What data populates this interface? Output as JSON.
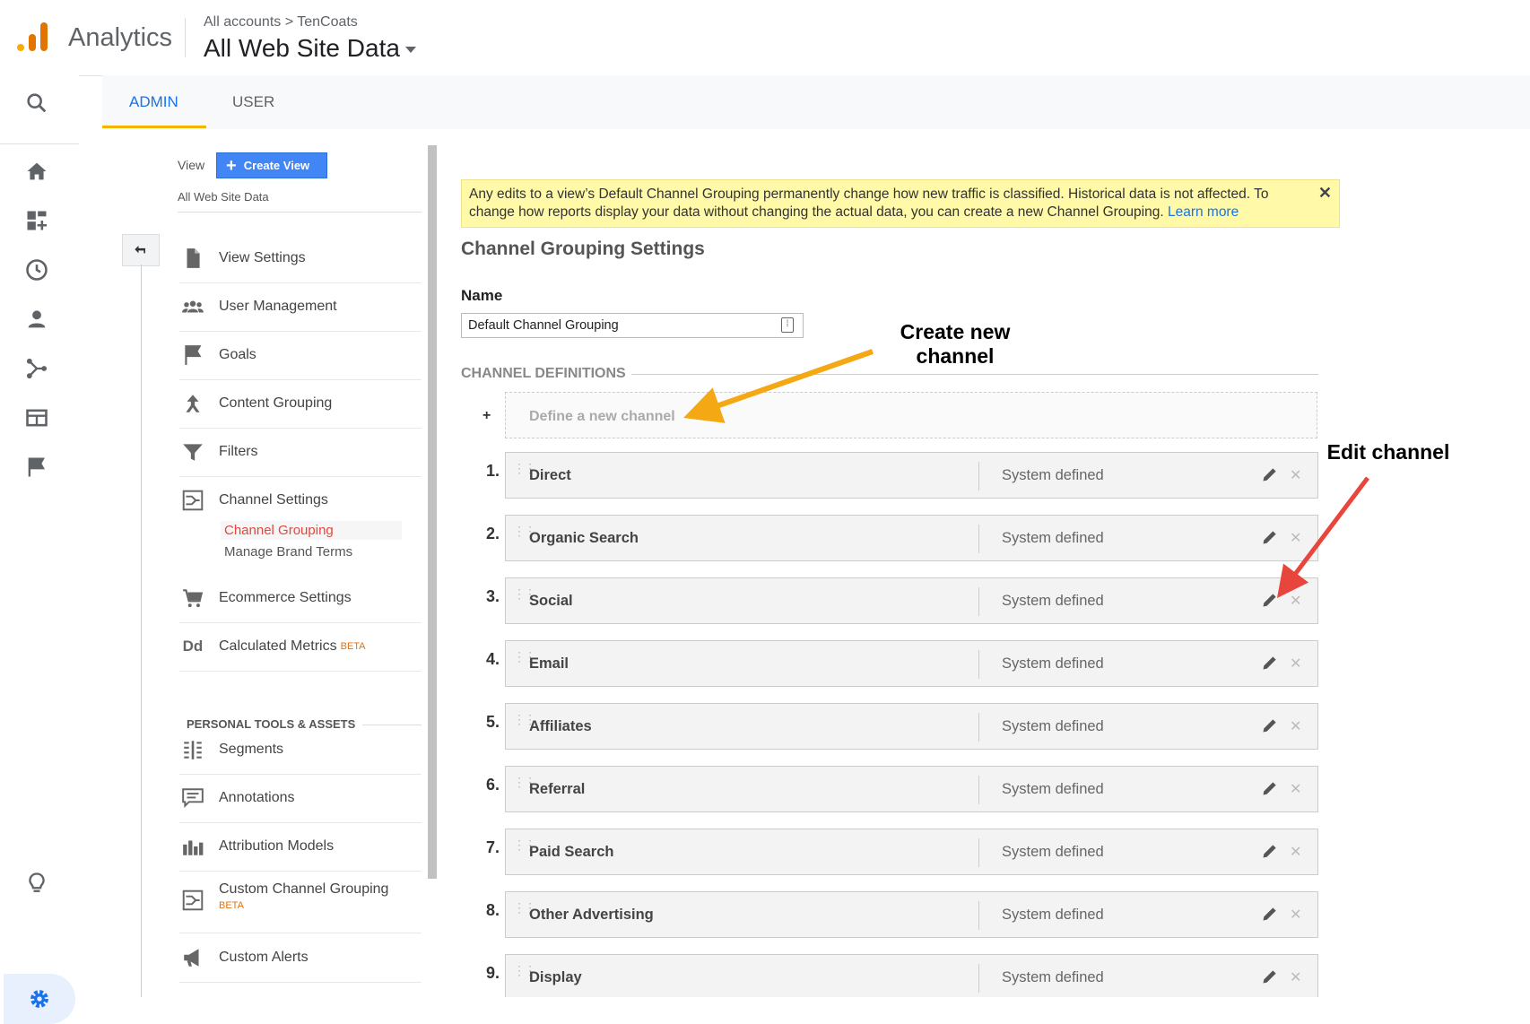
{
  "header": {
    "app_name": "Analytics",
    "breadcrumb": "All accounts > TenCoats",
    "property_title": "All Web Site Data"
  },
  "tabs": {
    "admin": "ADMIN",
    "user": "USER",
    "active": "ADMIN"
  },
  "rail": {
    "icons": [
      "search-icon",
      "home-icon",
      "customization-icon",
      "realtime-icon",
      "audience-icon",
      "acquisition-icon",
      "behavior-icon",
      "conversions-icon",
      "discover-icon",
      "admin-gear-icon"
    ]
  },
  "nav": {
    "view_label": "View",
    "create_view": "Create View",
    "view_name": "All Web Site Data",
    "items": [
      {
        "label": "View Settings",
        "icon": "document-icon"
      },
      {
        "label": "User Management",
        "icon": "users-icon"
      },
      {
        "label": "Goals",
        "icon": "flag-icon"
      },
      {
        "label": "Content Grouping",
        "icon": "content-grouping-icon"
      },
      {
        "label": "Filters",
        "icon": "filter-icon"
      },
      {
        "label": "Channel Settings",
        "icon": "channel-settings-icon"
      }
    ],
    "sub_items": [
      "Channel Grouping",
      "Manage Brand Terms"
    ],
    "items_after": [
      {
        "label": "Ecommerce Settings",
        "icon": "cart-icon"
      },
      {
        "label": "Calculated Metrics",
        "icon": "calculated-metrics-icon",
        "badge": "BETA"
      }
    ],
    "section_title": "PERSONAL TOOLS & ASSETS",
    "tools": [
      {
        "label": "Segments",
        "icon": "segments-icon"
      },
      {
        "label": "Annotations",
        "icon": "annotations-icon"
      },
      {
        "label": "Attribution Models",
        "icon": "attribution-icon"
      },
      {
        "label": "Custom Channel Grouping",
        "icon": "custom-channel-icon",
        "badge": "BETA"
      },
      {
        "label": "Custom Alerts",
        "icon": "megaphone-icon"
      }
    ]
  },
  "alert": {
    "text": "Any edits to a view’s Default Channel Grouping permanently change how new traffic is classified. Historical data is not affected. To change how reports display your data without changing the actual data, you can create a new Channel Grouping.",
    "link": "Learn more",
    "close": "✕"
  },
  "main": {
    "title": "Channel Grouping Settings",
    "name_label": "Name",
    "name_value": "Default Channel Grouping",
    "definitions_heading": "CHANNEL DEFINITIONS",
    "define_plus": "+",
    "define_new": "Define a new channel",
    "channels": [
      {
        "num": "1.",
        "name": "Direct",
        "type": "System defined"
      },
      {
        "num": "2.",
        "name": "Organic Search",
        "type": "System defined"
      },
      {
        "num": "3.",
        "name": "Social",
        "type": "System defined"
      },
      {
        "num": "4.",
        "name": "Email",
        "type": "System defined"
      },
      {
        "num": "5.",
        "name": "Affiliates",
        "type": "System defined"
      },
      {
        "num": "6.",
        "name": "Referral",
        "type": "System defined"
      },
      {
        "num": "7.",
        "name": "Paid Search",
        "type": "System defined"
      },
      {
        "num": "8.",
        "name": "Other Advertising",
        "type": "System defined"
      },
      {
        "num": "9.",
        "name": "Display",
        "type": "System defined"
      }
    ]
  },
  "annotations": {
    "create_line1": "Create new",
    "create_line2": "channel",
    "edit": "Edit channel",
    "create_color": "#F4A814",
    "edit_color": "#E8453C"
  },
  "colors": {
    "accent": "#1a73e8",
    "tab_underline": "#f4b400",
    "create_view_button": "#4285f4",
    "alert_background": "#fff9a8",
    "active_subitem": "#e8453c",
    "beta": "#e8710a"
  }
}
